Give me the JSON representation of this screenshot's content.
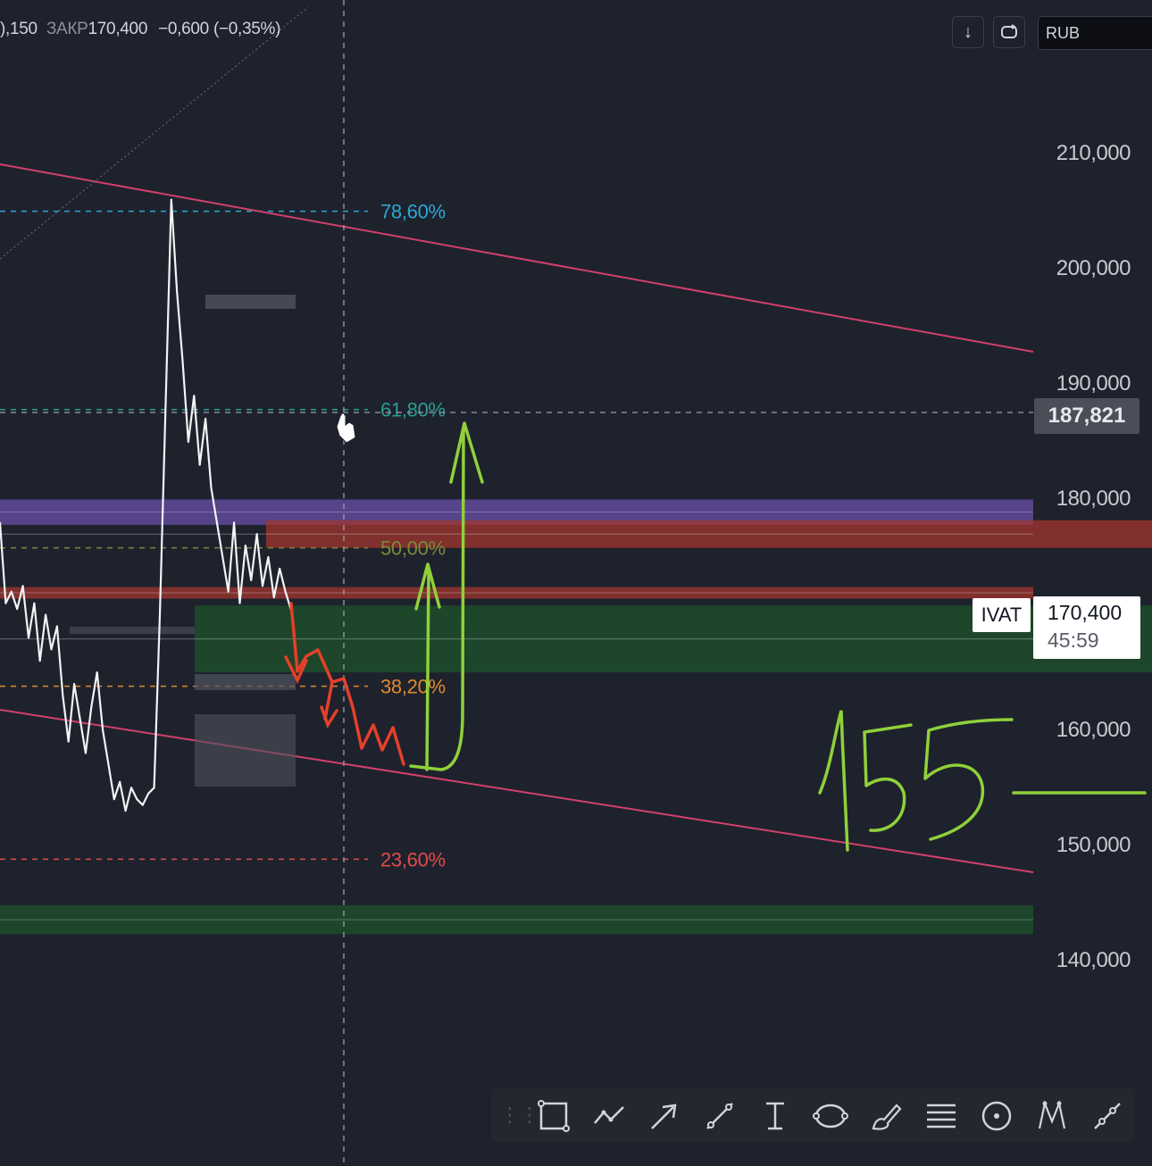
{
  "header": {
    "open_partial": "),150",
    "close_label": "ЗАКР",
    "close_value": "170,400",
    "change": "−0,600",
    "change_pct": "(−0,35%)",
    "currency": "RUB",
    "download_icon": "arrow-down-icon",
    "refresh_icon": "refresh-icon"
  },
  "chart_data": {
    "type": "line",
    "ylim": [
      135000,
      218000
    ],
    "y_ticks": [
      "210,000",
      "200,000",
      "190,000",
      "180,000",
      "160,000",
      "150,000",
      "140,000"
    ],
    "y_tick_values": [
      210000,
      200000,
      190000,
      180000,
      160000,
      150000,
      140000
    ],
    "series": [
      {
        "values": [
          178000,
          171000,
          172000,
          170500,
          172500,
          168000,
          171000,
          166000,
          170000,
          167000,
          169000,
          163000,
          159000,
          164000,
          161000,
          158000,
          162000,
          165000,
          160000,
          157000,
          154000,
          155500,
          153000,
          155000,
          154000,
          153500,
          154500,
          155000,
          170000,
          188000,
          206000,
          198000,
          192000,
          185000,
          189000,
          183000,
          187000,
          181000,
          178000,
          175000,
          172000,
          178000,
          171000,
          176000,
          173000,
          177000,
          172500,
          175000,
          171500,
          174000,
          172000,
          170400
        ]
      }
    ],
    "fibonacci": [
      {
        "label": "78,60%",
        "value": 205000,
        "color": "#2fa6d4"
      },
      {
        "label": "61,80%",
        "value": 187800,
        "color": "#2a9d8f"
      },
      {
        "label": "50,00%",
        "value": 175800,
        "color": "#7a8b3c"
      },
      {
        "label": "38,20%",
        "value": 163800,
        "color": "#e08a2c"
      },
      {
        "label": "23,60%",
        "value": 148800,
        "color": "#e04b4b"
      }
    ],
    "zones": [
      {
        "from": 177800,
        "to": 180000,
        "color": "purple"
      },
      {
        "from": 175800,
        "to": 178200,
        "color": "red"
      },
      {
        "from": 171400,
        "to": 172400,
        "color": "red"
      },
      {
        "from": 165000,
        "to": 170800,
        "color": "green"
      },
      {
        "from": 142300,
        "to": 144800,
        "color": "green"
      }
    ],
    "crosshair_value": "187,821",
    "last_price": {
      "ticker": "IVAT",
      "price": "170,400",
      "timer": "45:59",
      "value": 170400
    },
    "annotation": "155",
    "grid": false
  },
  "toolbar": {
    "tools": [
      "rectangle-icon",
      "path-icon",
      "arrow-icon",
      "trend-line-icon",
      "text-cursor-icon",
      "ellipse-icon",
      "brush-icon",
      "fib-levels-icon",
      "circle-icon",
      "pattern-icon",
      "ray-icon"
    ]
  }
}
